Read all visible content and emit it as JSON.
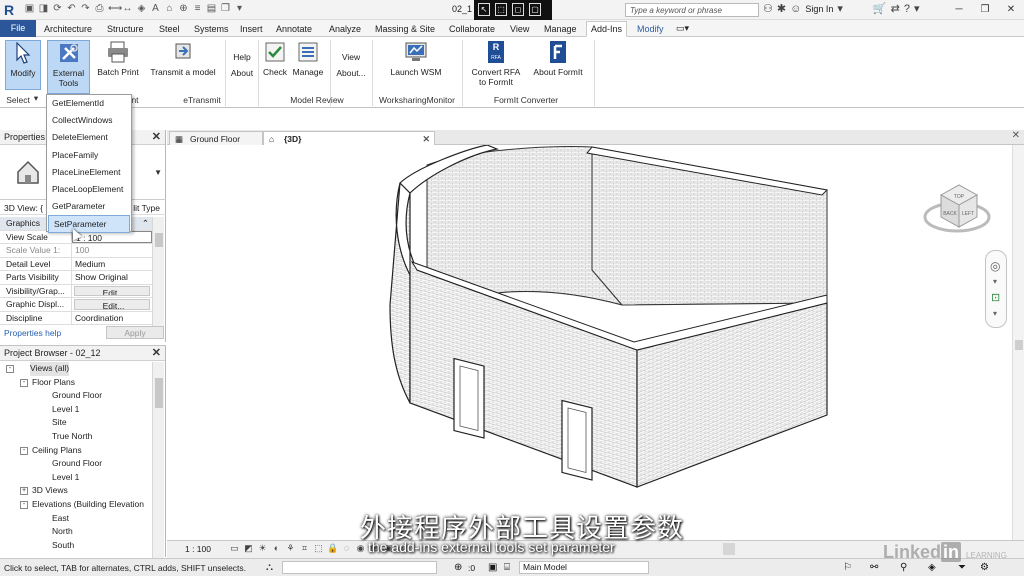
{
  "app": {
    "logo_letter": "R",
    "doc_name": "02_1"
  },
  "titlebar": {
    "search_placeholder": "Type a keyword or phrase",
    "sign_in": "Sign In"
  },
  "tabs": [
    {
      "label": "File"
    },
    {
      "label": "Architecture"
    },
    {
      "label": "Structure"
    },
    {
      "label": "Steel"
    },
    {
      "label": "Systems"
    },
    {
      "label": "Insert"
    },
    {
      "label": "Annotate"
    },
    {
      "label": "Analyze"
    },
    {
      "label": "Massing & Site"
    },
    {
      "label": "Collaborate"
    },
    {
      "label": "View"
    },
    {
      "label": "Manage"
    },
    {
      "label": "Add-Ins"
    },
    {
      "label": "Modify"
    }
  ],
  "ribbon": {
    "modify": "Modify",
    "external_tools": "External Tools",
    "batch_print": "Batch Print",
    "transmit": "Transmit a model",
    "help": "Help",
    "about": "About",
    "check": "Check",
    "manage": "Manage",
    "view": "View",
    "about2": "About...",
    "launch_wsm": "Launch WSM",
    "convert_rfa_1": "Convert RFA",
    "convert_rfa_2": "to FormIt",
    "about_formit": "About FormIt",
    "rfa_badge": "RFA",
    "groups": {
      "select": "Select",
      "external_tail": "nt",
      "etransmit": "eTransmit",
      "model_review": "Model Review",
      "worksharing": "WorksharingMonitor",
      "formit": "FormIt Converter"
    }
  },
  "dropdown": {
    "items": [
      "GetElementId",
      "CollectWindows",
      "DeleteElement",
      "PlaceFamily",
      "PlaceLineElement",
      "PlaceLoopElement",
      "GetParameter",
      "SetParameter"
    ],
    "highlighted_index": 7
  },
  "properties": {
    "title": "Properties",
    "view_label": "3D View: {",
    "edit_type": "lit Type",
    "rows": [
      {
        "k": "Graphics",
        "v": "",
        "group": true
      },
      {
        "k": "View Scale",
        "v": "1 : 100"
      },
      {
        "k": "Scale Value   1:",
        "v": "100",
        "dim": true
      },
      {
        "k": "Detail Level",
        "v": "Medium"
      },
      {
        "k": "Parts Visibility",
        "v": "Show Original"
      },
      {
        "k": "Visibility/Grap...",
        "v": "Edit...",
        "btn": true
      },
      {
        "k": "Graphic Displ...",
        "v": "Edit...",
        "btn": true
      },
      {
        "k": "Discipline",
        "v": "Coordination"
      }
    ],
    "help_link": "Properties help",
    "apply": "Apply"
  },
  "browser": {
    "title": "Project Browser - 02_12",
    "items": [
      {
        "label": "Views (all)",
        "indent": 0,
        "tog": "-",
        "sel": true
      },
      {
        "label": "Floor Plans",
        "indent": 1,
        "tog": "-"
      },
      {
        "label": "Ground Floor",
        "indent": 2
      },
      {
        "label": "Level 1",
        "indent": 2
      },
      {
        "label": "Site",
        "indent": 2
      },
      {
        "label": "True North",
        "indent": 2
      },
      {
        "label": "Ceiling Plans",
        "indent": 1,
        "tog": "-"
      },
      {
        "label": "Ground Floor",
        "indent": 2
      },
      {
        "label": "Level 1",
        "indent": 2
      },
      {
        "label": "3D Views",
        "indent": 1,
        "tog": "+"
      },
      {
        "label": "Elevations (Building Elevation",
        "indent": 1,
        "tog": "-"
      },
      {
        "label": "East",
        "indent": 2
      },
      {
        "label": "North",
        "indent": 2
      },
      {
        "label": "South",
        "indent": 2
      }
    ]
  },
  "viewtabs": [
    {
      "label": "Ground Floor",
      "active": false
    },
    {
      "label": "{3D}",
      "active": true
    }
  ],
  "viewcube": {
    "top": "TOP",
    "back": "BACK",
    "left": "LEFT"
  },
  "viewctrl": {
    "scale": "1 : 100"
  },
  "status": {
    "message": "Click to select, TAB for alternates, CTRL adds, SHIFT unselects.",
    "zero": ":0",
    "model": "Main Model"
  },
  "subtitle": {
    "zh": "外接程序外部工具设置参数",
    "en": "the add-ins external tools set parameter"
  },
  "watermark": {
    "brand": "Linked",
    "brand_in": "in",
    "sub": "LEARNING"
  },
  "colors": {
    "file_tab": "#2b579a",
    "selected": "#bcd8f4",
    "brick": "#b8b8b8"
  }
}
